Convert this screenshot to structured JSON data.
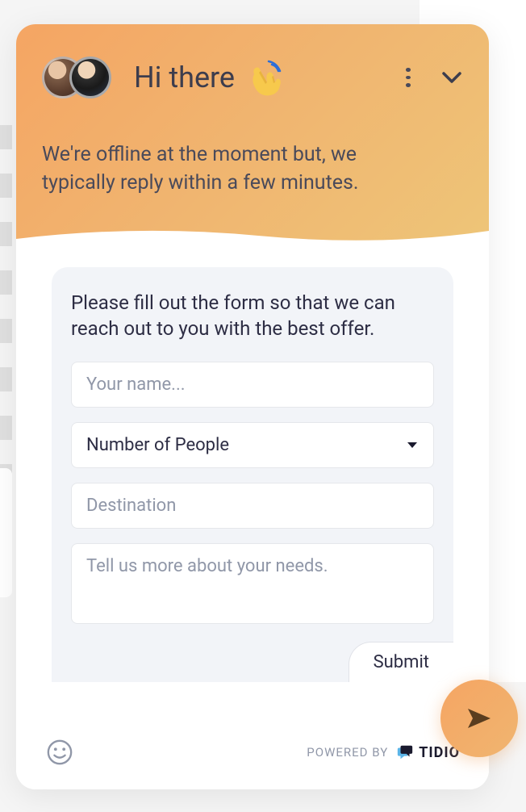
{
  "header": {
    "greeting": "Hi there",
    "status_message": "We're offline at the moment but, we typically reply within a few minutes."
  },
  "form": {
    "intro": "Please fill out the form so that we can reach out to you with the best offer.",
    "name_placeholder": "Your name...",
    "people_label": "Number of People",
    "destination_placeholder": "Destination",
    "needs_placeholder": "Tell us more about your needs.",
    "submit_label": "Submit"
  },
  "footer": {
    "powered_by_label": "POWERED BY",
    "brand_name": "TIDIO"
  },
  "icons": {
    "menu_dots": "menu-dots-icon",
    "chevron_down": "chevron-down-icon",
    "wave": "wave-icon",
    "emoji": "emoji-icon",
    "send": "send-icon"
  }
}
